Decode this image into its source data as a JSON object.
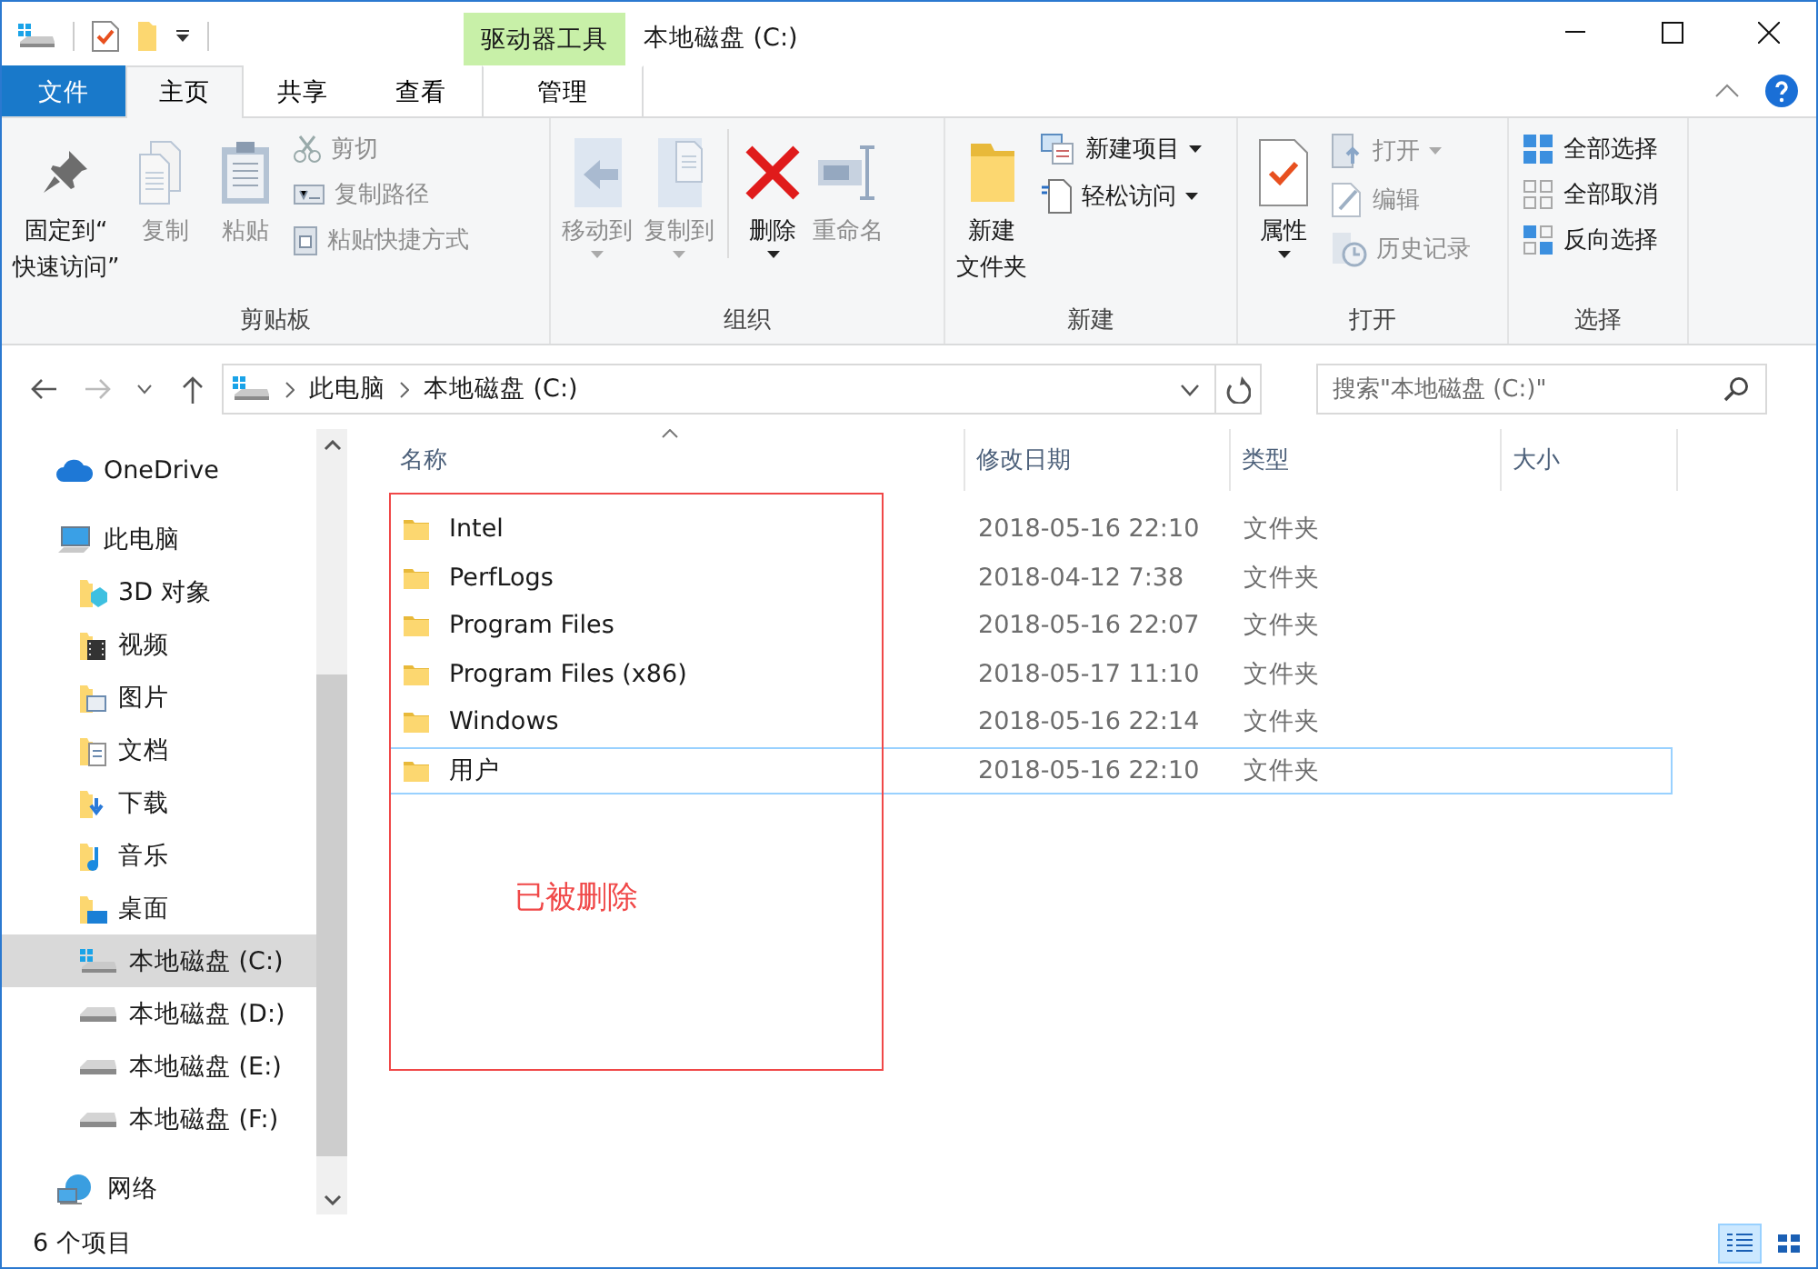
{
  "title_bar": {
    "contextual_tab": "驱动器工具",
    "title": "本地磁盘 (C:)"
  },
  "tabs": [
    {
      "label": "文件",
      "kind": "file",
      "selected": false
    },
    {
      "label": "主页",
      "kind": "tab",
      "selected": true
    },
    {
      "label": "共享",
      "kind": "tab",
      "selected": false
    },
    {
      "label": "查看",
      "kind": "tab",
      "selected": false
    },
    {
      "label": "管理",
      "kind": "contextual",
      "selected": false
    }
  ],
  "ribbon_groups": [
    {
      "label": "剪贴板",
      "large": [
        {
          "lines": [
            "固定到“",
            "快速访问”"
          ],
          "disabled": false,
          "dropdown": false
        },
        {
          "lines": [
            "复制"
          ],
          "disabled": true,
          "dropdown": false
        },
        {
          "lines": [
            "粘贴"
          ],
          "disabled": true,
          "dropdown": false
        }
      ],
      "small": [
        {
          "label": "剪切",
          "disabled": true,
          "dropdown": false
        },
        {
          "label": "复制路径",
          "disabled": true,
          "dropdown": false
        },
        {
          "label": "粘贴快捷方式",
          "disabled": true,
          "dropdown": false
        }
      ]
    },
    {
      "label": "组织",
      "large": [
        {
          "lines": [
            "移动到"
          ],
          "disabled": true,
          "dropdown": true
        },
        {
          "lines": [
            "复制到"
          ],
          "disabled": true,
          "dropdown": true
        },
        {
          "lines": [
            "删除"
          ],
          "disabled": false,
          "dropdown": true
        },
        {
          "lines": [
            "重命名"
          ],
          "disabled": true,
          "dropdown": false
        }
      ]
    },
    {
      "label": "新建",
      "large": [
        {
          "lines": [
            "新建",
            "文件夹"
          ],
          "disabled": false,
          "dropdown": false
        }
      ],
      "small": [
        {
          "label": "新建项目",
          "disabled": false,
          "dropdown": true
        },
        {
          "label": "轻松访问",
          "disabled": false,
          "dropdown": true
        }
      ]
    },
    {
      "label": "打开",
      "large": [
        {
          "lines": [
            "属性"
          ],
          "disabled": false,
          "dropdown": true
        }
      ],
      "small": [
        {
          "label": "打开",
          "disabled": true,
          "dropdown": true
        },
        {
          "label": "编辑",
          "disabled": true,
          "dropdown": false
        },
        {
          "label": "历史记录",
          "disabled": true,
          "dropdown": false
        }
      ]
    },
    {
      "label": "选择",
      "small": [
        {
          "label": "全部选择",
          "disabled": false,
          "dropdown": false
        },
        {
          "label": "全部取消",
          "disabled": false,
          "dropdown": false
        },
        {
          "label": "反向选择",
          "disabled": false,
          "dropdown": false
        }
      ]
    }
  ],
  "address_bar": {
    "breadcrumbs": [
      "此电脑",
      "本地磁盘 (C:)"
    ],
    "forward_disabled": true
  },
  "search": {
    "placeholder": "搜索\"本地磁盘 (C:)\""
  },
  "sidebar": {
    "items": [
      {
        "label": "OneDrive",
        "selected": false
      },
      {
        "label": "此电脑",
        "selected": false,
        "children": [
          {
            "label": "3D 对象",
            "selected": false
          },
          {
            "label": "视频",
            "selected": false
          },
          {
            "label": "图片",
            "selected": false
          },
          {
            "label": "文档",
            "selected": false
          },
          {
            "label": "下载",
            "selected": false
          },
          {
            "label": "音乐",
            "selected": false
          },
          {
            "label": "桌面",
            "selected": false
          },
          {
            "label": "本地磁盘 (C:)",
            "selected": true
          },
          {
            "label": "本地磁盘 (D:)",
            "selected": false
          },
          {
            "label": "本地磁盘 (E:)",
            "selected": false
          },
          {
            "label": "本地磁盘 (F:)",
            "selected": false
          }
        ]
      },
      {
        "label": "网络",
        "selected": false
      }
    ]
  },
  "table": {
    "columns": [
      {
        "label": "名称",
        "sorted": true
      },
      {
        "label": "修改日期",
        "sorted": false
      },
      {
        "label": "类型",
        "sorted": false
      },
      {
        "label": "大小",
        "sorted": false
      }
    ],
    "rows": [
      {
        "name": "Intel",
        "date": "2018-05-16 22:10",
        "type": "文件夹",
        "focused": false
      },
      {
        "name": "PerfLogs",
        "date": "2018-04-12 7:38",
        "type": "文件夹",
        "focused": false
      },
      {
        "name": "Program Files",
        "date": "2018-05-16 22:07",
        "type": "文件夹",
        "focused": false
      },
      {
        "name": "Program Files (x86)",
        "date": "2018-05-17 11:10",
        "type": "文件夹",
        "focused": false
      },
      {
        "name": "Windows",
        "date": "2018-05-16 22:14",
        "type": "文件夹",
        "focused": false
      },
      {
        "name": "用户",
        "date": "2018-05-16 22:10",
        "type": "文件夹",
        "focused": true
      }
    ]
  },
  "annotation": {
    "text": "已被删除"
  },
  "status_bar": {
    "count": "6 个项目",
    "views": [
      {
        "kind": "details",
        "selected": true
      },
      {
        "kind": "large-icons",
        "selected": false
      }
    ]
  }
}
